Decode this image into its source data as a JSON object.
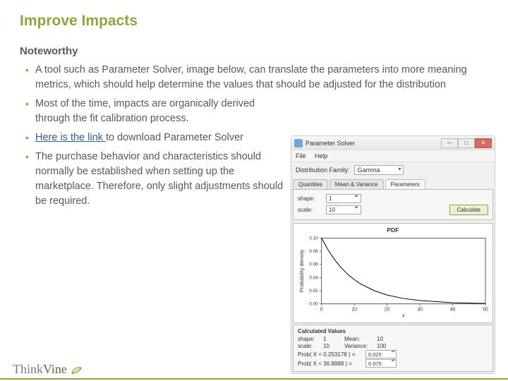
{
  "title": "Improve Impacts",
  "subhead": "Noteworthy",
  "bullets": [
    "A tool such as Parameter Solver, image below, can translate the parameters into more meaning metrics, which should help determine the values that should be adjusted for the distribution",
    "Most of the time, impacts are organically derived through the fit calibration process.",
    "____LINK____ to download Parameter Solver",
    "The purchase behavior and characteristics should normally be established when setting up the marketplace.  Therefore, only slight adjustments should be required."
  ],
  "link_text": "Here is the link ",
  "footer": {
    "think": "Think",
    "vine": "Vine"
  },
  "app": {
    "title": "Parameter Solver",
    "menu": {
      "file": "File",
      "help": "Help"
    },
    "dist_label": "Distribution Family:",
    "dist_value": "Gamma",
    "tabs": {
      "quantiles": "Quantiles",
      "meanvar": "Mean & Variance",
      "parameters": "Parameters"
    },
    "params": {
      "shape_label": "shape:",
      "shape_value": "1",
      "scale_label": "scale:",
      "scale_value": "10"
    },
    "calc_btn": "Calculate",
    "plot_title": "PDF",
    "xlabel": "x",
    "ylabel": "Probability density",
    "calcvals": {
      "head": "Calculated Values",
      "shape_label": "shape:",
      "shape": "1",
      "mean_label": "Mean:",
      "mean": "10",
      "scale_label": "scale:",
      "scale": "10",
      "var_label": "Variance:",
      "var": "100",
      "p1_label": "Prob( X < 0.253178 ) =",
      "p1": "0.025",
      "p2_label": "Prob( X < 36.8888 ) =",
      "p2": "0.975"
    }
  },
  "chart_data": {
    "type": "line",
    "title": "PDF",
    "xlabel": "x",
    "ylabel": "Probability density",
    "xlim": [
      0,
      50
    ],
    "ylim": [
      0,
      0.1
    ],
    "x_ticks": [
      0,
      10,
      20,
      30,
      40,
      50
    ],
    "y_ticks": [
      0.0,
      0.02,
      0.04,
      0.06,
      0.08,
      0.1
    ],
    "series": [
      {
        "name": "PDF",
        "x": [
          0,
          2,
          4,
          6,
          8,
          10,
          12,
          16,
          20,
          25,
          30,
          40,
          50
        ],
        "y": [
          0.1,
          0.0819,
          0.067,
          0.0549,
          0.0449,
          0.0368,
          0.0301,
          0.0202,
          0.0135,
          0.0082,
          0.005,
          0.0018,
          0.0007
        ]
      }
    ]
  }
}
